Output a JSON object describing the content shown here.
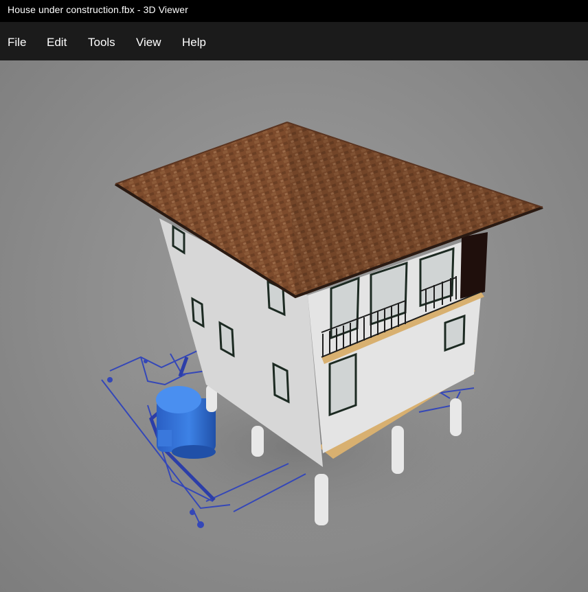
{
  "window": {
    "title": "House under construction.fbx - 3D Viewer"
  },
  "menu": {
    "items": [
      {
        "label": "File"
      },
      {
        "label": "Edit"
      },
      {
        "label": "Tools"
      },
      {
        "label": "View"
      },
      {
        "label": "Help"
      }
    ]
  },
  "viewport": {
    "model_name": "House under construction",
    "colors": {
      "background": "#8f8f8f",
      "roof": "#7a4a2c",
      "walls": "#e6e6e6",
      "plumbing": "#3447b8",
      "tank": "#2f6fd1",
      "decks": "#d8b070"
    }
  }
}
